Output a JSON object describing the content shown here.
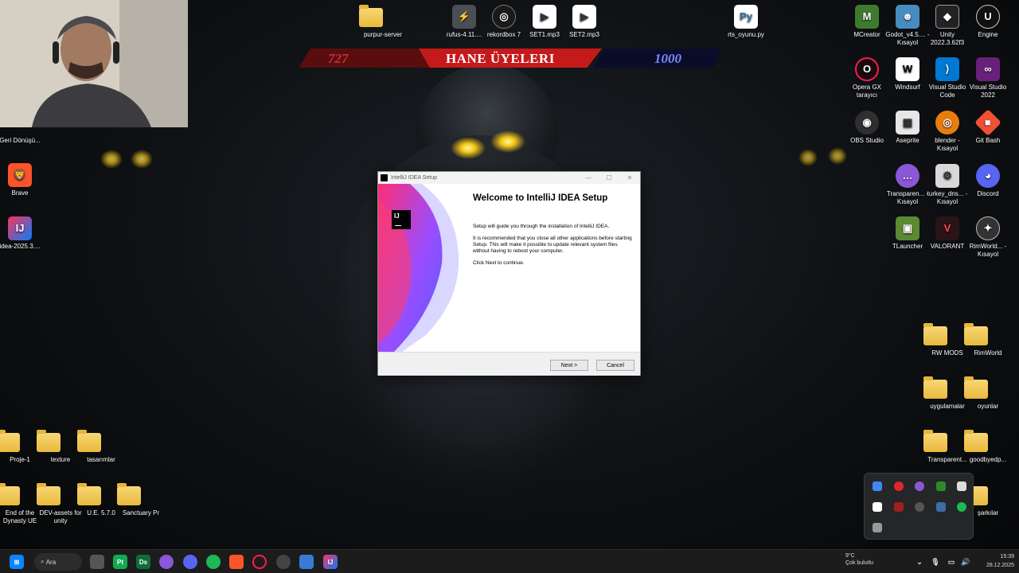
{
  "banner": {
    "left_number": "727",
    "title": "HANE ÜYELERI",
    "right_number": "1000"
  },
  "top_icons": [
    {
      "label": "purpur-server"
    },
    {
      "label": "rufus-4.11...."
    },
    {
      "label": "rekordbox 7"
    },
    {
      "label": "SET1.mp3"
    },
    {
      "label": "SET2.mp3"
    },
    {
      "label": "rts_oyunu.py"
    }
  ],
  "left_icons": [
    {
      "label": "Geri Dönüşü..."
    },
    {
      "label": "Brave"
    },
    {
      "label": "idea-2025.3...."
    }
  ],
  "bottom_left_icons": [
    {
      "label": "Proje-1"
    },
    {
      "label": "texture"
    },
    {
      "label": "tasarımlar"
    },
    {
      "label": "End of the Dynasty UE"
    },
    {
      "label": "DEV-assets for unity"
    },
    {
      "label": "U.E. 5.7.0"
    },
    {
      "label": "Sanctuary Pr"
    }
  ],
  "right_icons": [
    {
      "label": "MCreator"
    },
    {
      "label": "Godot_v4.5.... - Kısayol"
    },
    {
      "label": "Unity 2022.3.62f3"
    },
    {
      "label": "Engine"
    },
    {
      "label": "Opera GX tarayıcı"
    },
    {
      "label": "Windsurf"
    },
    {
      "label": "Visual Studio Code"
    },
    {
      "label": "Visual Studio 2022"
    },
    {
      "label": "OBS Studio"
    },
    {
      "label": "Aseprite"
    },
    {
      "label": "blender - Kısayol"
    },
    {
      "label": "Git Bash"
    },
    {
      "label": "Transparen... - Kısayol"
    },
    {
      "label": "turkey_dns... - Kısayol"
    },
    {
      "label": "Discord"
    },
    {
      "label": "TLauncher"
    },
    {
      "label": "VALORANT"
    },
    {
      "label": "RimWorld... - Kısayol"
    },
    {
      "label": "RW MODS"
    },
    {
      "label": "RimWorld"
    },
    {
      "label": "uygulamalar"
    },
    {
      "label": "oyunlar"
    },
    {
      "label": "Transparent..."
    },
    {
      "label": "goodbyedp..."
    },
    {
      "label": "şarkılar"
    }
  ],
  "dialog": {
    "title": "IntelliJ IDEA Setup",
    "logo_text": "IJ",
    "heading": "Welcome to IntelliJ IDEA Setup",
    "para1": "Setup will guide you through the installation of IntelliJ IDEA.",
    "para2": "It is recommended that you close all other applications before starting Setup. This will make it possible to update relevant system files without having to reboot your computer.",
    "para3": "Click Next to continue.",
    "next_label": "Next >",
    "cancel_label": "Cancel"
  },
  "taskbar": {
    "search_label": "Ara",
    "weather_temp": "9°C",
    "weather_desc": "Çok bulutlu",
    "time": "15:39",
    "date": "28.12.2025"
  },
  "colors": {
    "accent_blue": "#3574f0",
    "banner_red": "#c51a1a"
  }
}
